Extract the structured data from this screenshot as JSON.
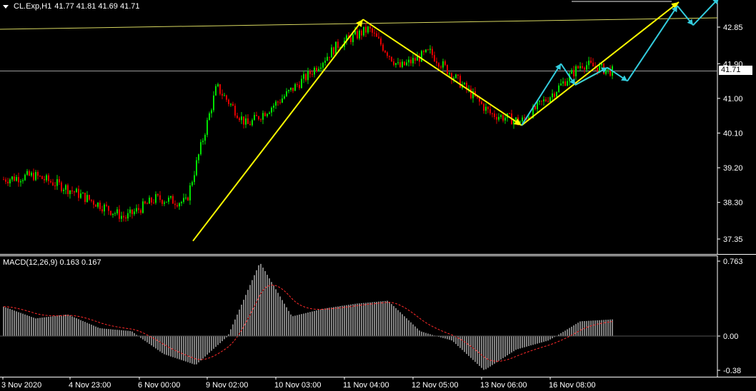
{
  "header": {
    "symbol": "CL.Exp,H1",
    "ohlc": "41.77 41.81 41.69 41.71"
  },
  "price_axis": {
    "ticks": [
      "42.85",
      "41.90",
      "41.00",
      "40.10",
      "39.20",
      "38.30",
      "37.35"
    ],
    "ticks_num": [
      42.85,
      41.9,
      41.0,
      40.1,
      39.2,
      38.3,
      37.35
    ],
    "current_price": "41.71",
    "range": [
      36.95,
      43.45
    ]
  },
  "macd": {
    "label": "MACD(12,26,9) 0.163 0.167",
    "ticks": [
      "0.763",
      "0.00",
      "-0.38"
    ],
    "ticks_num": [
      0.763,
      0.0,
      -0.38
    ]
  },
  "time_axis": {
    "labels": [
      "3 Nov 2020",
      "4 Nov 23:00",
      "6 Nov 00:00",
      "9 Nov 02:00",
      "10 Nov 03:00",
      "11 Nov 04:00",
      "12 Nov 05:00",
      "13 Nov 06:00",
      "16 Nov 08:00"
    ]
  },
  "colors": {
    "background": "#000000",
    "bull_candle": "#00e000",
    "bear_candle": "#e00000",
    "trend_yellow": "#ffff00",
    "forecast_cyan": "#33ccdd",
    "macd_hist": "#ffffff",
    "macd_signal": "#ff2a2a",
    "grid": "#ffffff"
  },
  "chart_data": {
    "type": "candlestick",
    "symbol": "CL.Exp",
    "timeframe": "H1",
    "x": [
      "3 Nov 2020",
      "4 Nov 23:00",
      "6 Nov 00:00",
      "9 Nov 02:00",
      "10 Nov 03:00",
      "11 Nov 04:00",
      "12 Nov 05:00",
      "13 Nov 06:00",
      "16 Nov 08:00"
    ],
    "close_path": [
      38.9,
      39.0,
      38.7,
      38.3,
      37.9,
      38.4,
      38.3,
      41.3,
      40.3,
      40.9,
      41.6,
      42.4,
      42.8,
      41.8,
      42.2,
      41.4,
      40.6,
      40.4,
      41.1,
      41.9,
      41.7
    ],
    "ylim": [
      37.35,
      42.85
    ],
    "last": {
      "open": 41.77,
      "high": 41.81,
      "low": 41.69,
      "close": 41.71
    },
    "trendlines_yellow": [
      [
        37.3,
        43.05
      ],
      [
        43.05,
        40.3
      ],
      [
        40.3,
        43.5
      ]
    ],
    "forecast_cyan": [
      40.3,
      41.9,
      41.35,
      41.8,
      41.45,
      43.4,
      42.9,
      43.6
    ],
    "macd": {
      "name": "MACD(12,26,9)",
      "main": 0.163,
      "signal": 0.167,
      "ylim": [
        -0.38,
        0.763
      ],
      "histogram_path": [
        0.3,
        0.18,
        0.22,
        0.08,
        0.05,
        -0.2,
        -0.32,
        0.0,
        0.75,
        0.2,
        0.28,
        0.33,
        0.36,
        0.05,
        -0.05,
        -0.38,
        -0.15,
        -0.05,
        0.15,
        0.17
      ]
    }
  }
}
